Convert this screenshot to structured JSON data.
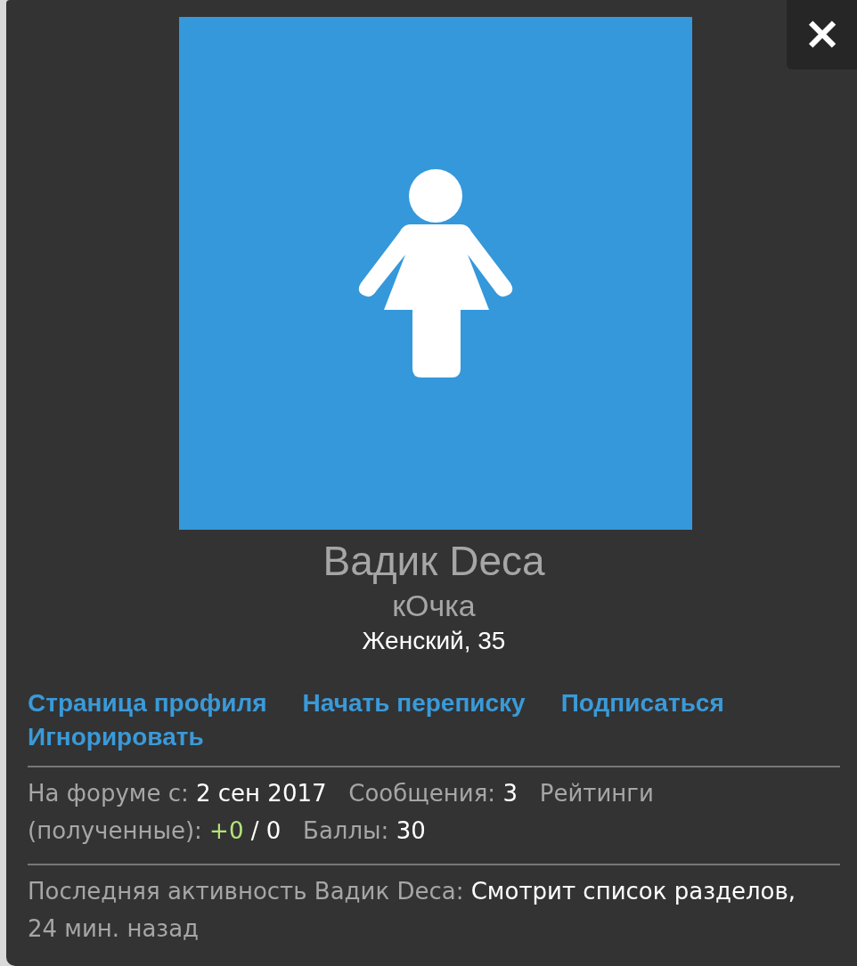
{
  "close_button": {
    "label": "✕"
  },
  "avatar": {
    "kind": "female"
  },
  "member": {
    "name": "Вадик Deca",
    "title": "кОчка",
    "gender_age": "Женский, 35"
  },
  "links": [
    "Страница профиля",
    "Начать переписку",
    "Подписаться",
    "Игнорировать"
  ],
  "stats": [
    {
      "label": "На форуме с:",
      "value": "2 сен 2017"
    },
    {
      "label": "Сообщения:",
      "value": "3"
    },
    {
      "label": "Рейтинги (полученные):",
      "positive": "+0",
      "value": "/ 0"
    },
    {
      "label": "Баллы:",
      "value": "30"
    }
  ],
  "last_activity": {
    "label": "Последняя активность Вадик Deca:",
    "action": "Смотрит список разделов,",
    "time": "24 мин. назад"
  }
}
